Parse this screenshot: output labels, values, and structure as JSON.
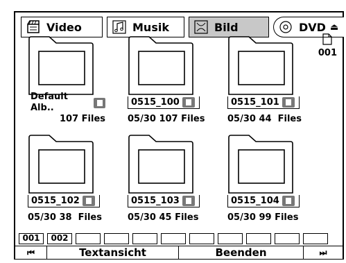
{
  "tabs": [
    {
      "label": "Video",
      "icon": "film-icon"
    },
    {
      "label": "Musik",
      "icon": "music-note-icon"
    },
    {
      "label": "Bild",
      "icon": "photo-icon",
      "selected": true
    },
    {
      "label": "DVD",
      "icon": "disc-icon"
    }
  ],
  "page_counter": "001",
  "albums": [
    {
      "name": "Default Alb..",
      "date": "",
      "files": "107 Files"
    },
    {
      "name": "0515_100",
      "date": "05/30",
      "files": "107 Files"
    },
    {
      "name": "0515_101",
      "date": "05/30",
      "files": "44  Files"
    },
    {
      "name": "0515_102",
      "date": "05/30",
      "files": "38  Files"
    },
    {
      "name": "0515_103",
      "date": "05/30",
      "files": "45 Files"
    },
    {
      "name": "0515_104",
      "date": "05/30",
      "files": "99 Files"
    }
  ],
  "pages": [
    "001",
    "002",
    "",
    "",
    "",
    "",
    "",
    "",
    "",
    "",
    ""
  ],
  "bottom": {
    "prev": "⏮",
    "text_view": "Textansicht",
    "exit": "Beenden",
    "next": "⏭"
  }
}
